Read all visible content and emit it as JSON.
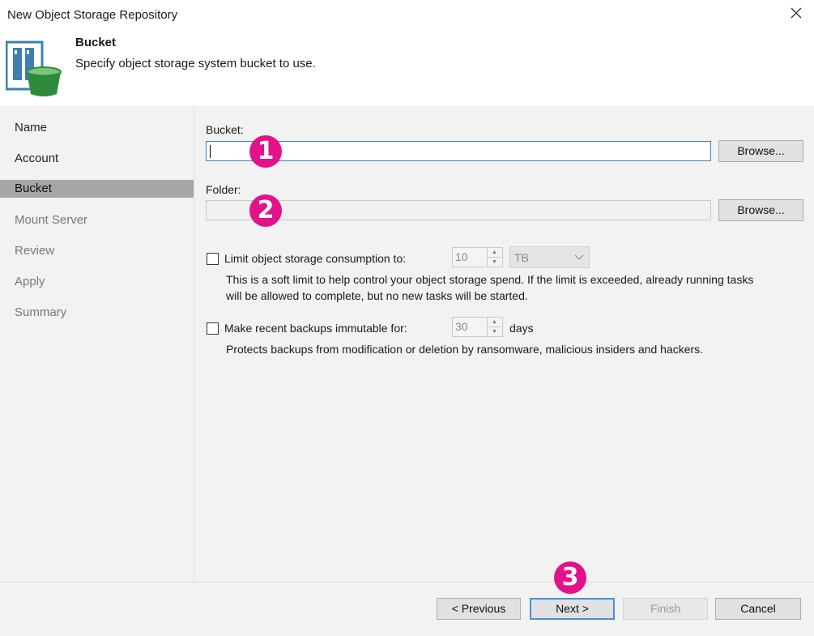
{
  "window": {
    "title": "New Object Storage Repository"
  },
  "header": {
    "title": "Bucket",
    "subtitle": "Specify object storage system bucket to use."
  },
  "sidebar": {
    "items": [
      {
        "label": "Name",
        "state": "normal"
      },
      {
        "label": "Account",
        "state": "normal"
      },
      {
        "label": "Bucket",
        "state": "active"
      },
      {
        "label": "Mount Server",
        "state": "disabled"
      },
      {
        "label": "Review",
        "state": "disabled"
      },
      {
        "label": "Apply",
        "state": "disabled"
      },
      {
        "label": "Summary",
        "state": "disabled"
      }
    ]
  },
  "form": {
    "bucket_label": "Bucket:",
    "bucket_value": "",
    "bucket_browse": "Browse...",
    "folder_label": "Folder:",
    "folder_value": "",
    "folder_browse": "Browse...",
    "limit_label": "Limit object storage consumption to:",
    "limit_value": "10",
    "limit_unit": "TB",
    "limit_desc_line1": "This is a soft limit to help control your object storage spend. If the limit is exceeded, already running tasks",
    "limit_desc_line2": "will be allowed to complete, but no new tasks will be started.",
    "immutable_label": "Make recent backups immutable for:",
    "immutable_value": "30",
    "immutable_unit": "days",
    "immutable_desc": "Protects backups from modification or deletion by ransomware, malicious insiders and hackers."
  },
  "buttons": {
    "previous": "< Previous",
    "next": "Next >",
    "finish": "Finish",
    "cancel": "Cancel"
  },
  "annotations": [
    "1",
    "2",
    "3"
  ],
  "colors": {
    "accent_badge": "#e4128a",
    "focus_border": "#3c7fb1",
    "default_button": "#4a90d9",
    "sidebar_active": "#a6a6a6"
  }
}
